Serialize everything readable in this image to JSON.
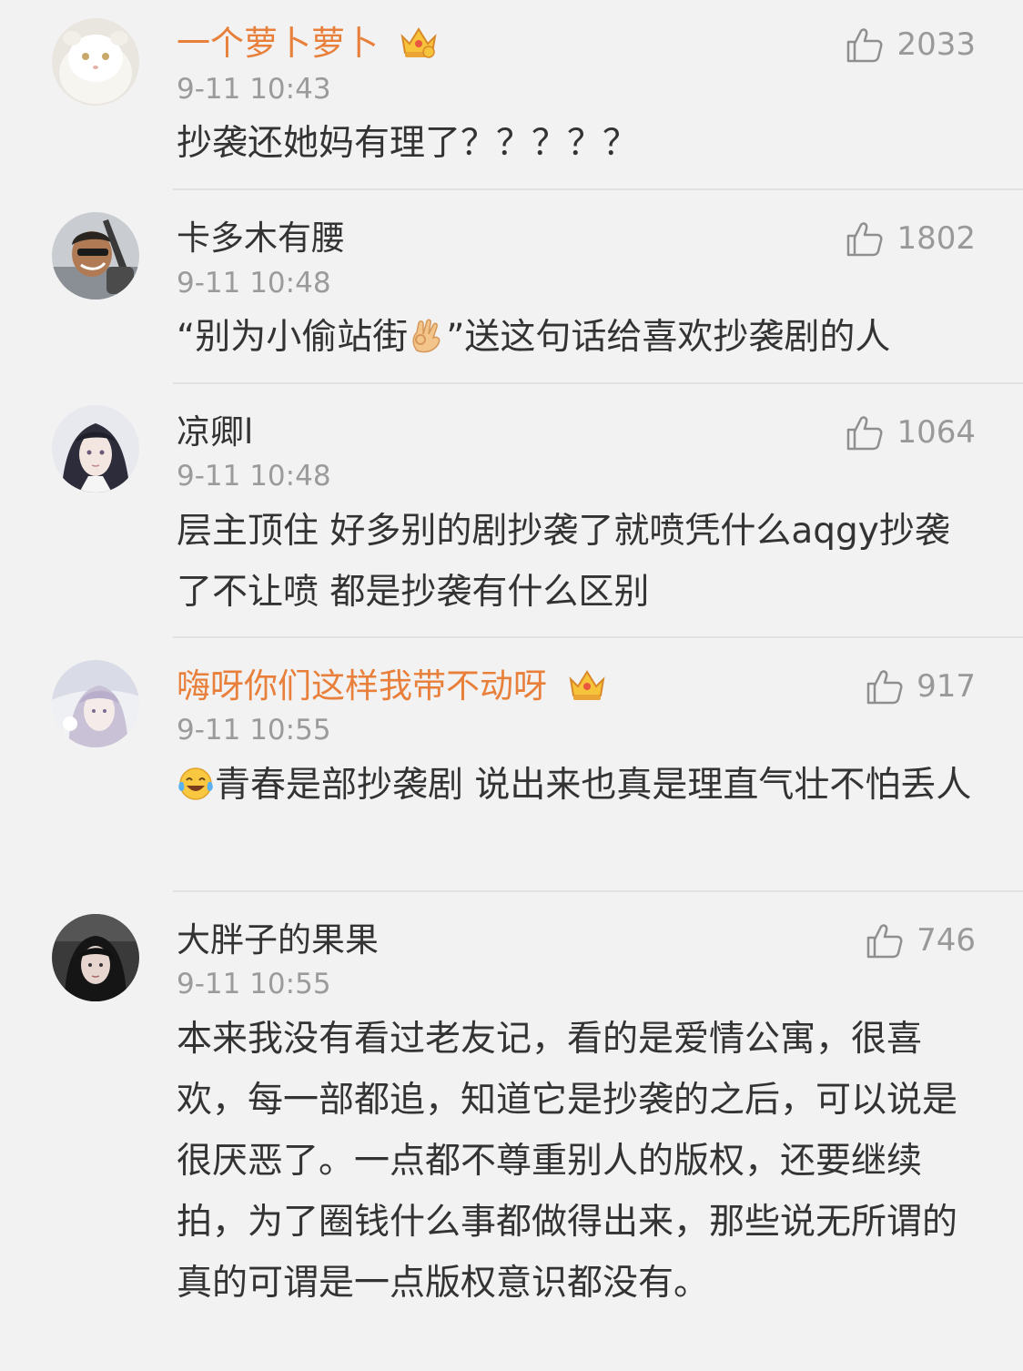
{
  "comments": [
    {
      "username": "一个萝卜萝卜",
      "vip": true,
      "time": "9-11 10:43",
      "likes": "2033",
      "text": "抄袭还她妈有理了？？？？？"
    },
    {
      "username": "卡多木有腰",
      "vip": false,
      "time": "9-11 10:48",
      "likes": "1802",
      "text_before": "“别为小偷站街",
      "text_after": "”送这句话给喜欢抄袭剧的人"
    },
    {
      "username": "凉卿l",
      "vip": false,
      "time": "9-11 10:48",
      "likes": "1064",
      "text": "层主顶住 好多别的剧抄袭了就喷凭什么aqgy抄袭了不让喷 都是抄袭有什么区别"
    },
    {
      "username": "嗨呀你们这样我带不动呀",
      "vip": true,
      "time": "9-11 10:55",
      "likes": "917",
      "text": "青春是部抄袭剧 说出来也真是理直气壮不怕丢人"
    },
    {
      "username": "大胖子的果果",
      "vip": false,
      "time": "9-11 10:55",
      "likes": "746",
      "text": "本来我没有看过老友记，看的是爱情公寓，很喜欢，每一部都追，知道它是抄袭的之后，可以说是很厌恶了。一点都不尊重别人的版权，还要继续拍，为了圈钱什么事都做得出来，那些说无所谓的真的可谓是一点版权意识都没有。"
    }
  ],
  "colors": {
    "background": "#f2f2f2",
    "vip_name": "#e8803b",
    "text": "#333333",
    "meta": "#9b9b9b"
  },
  "icons": {
    "like": "thumbs-up-outline-icon",
    "vip": "crown-icon",
    "emoji_ok": "ok-hand-emoji-icon",
    "emoji_laugh": "laughing-tears-emoji-icon"
  }
}
